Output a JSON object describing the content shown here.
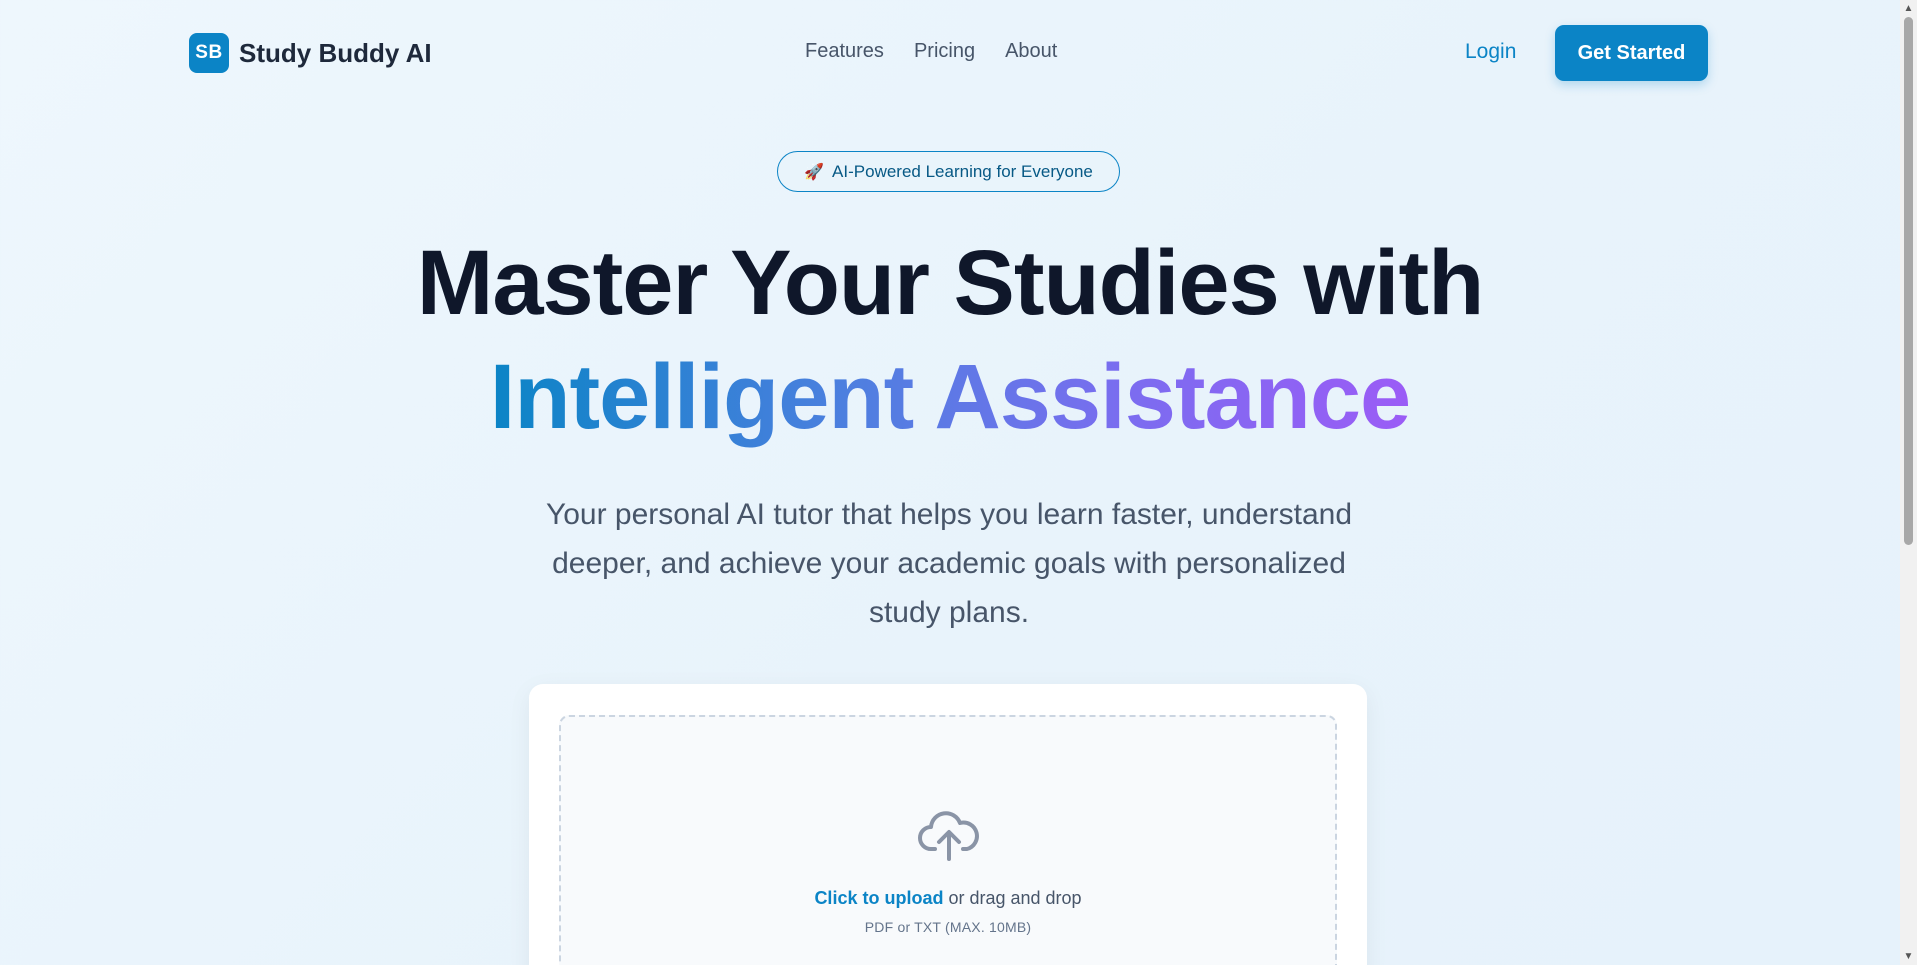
{
  "nav": {
    "logo_badge": "SB",
    "brand": "Study Buddy AI",
    "links": [
      "Features",
      "Pricing",
      "About"
    ],
    "login": "Login",
    "cta": "Get Started"
  },
  "hero": {
    "badge_icon": "rocket-icon",
    "badge": "AI-Powered Learning for Everyone",
    "headline_line1": "Master Your Studies with",
    "headline_line2": "Intelligent Assistance",
    "subtitle": "Your personal AI tutor that helps you learn faster, understand deeper, and achieve your academic goals with personalized study plans."
  },
  "upload": {
    "icon": "cloud-upload-icon",
    "link_text": "Click to upload",
    "rest_text": " or drag and drop",
    "hint": "PDF or TXT (MAX. 10MB)"
  },
  "colors": {
    "primary": "#0b84c6",
    "gradient_start": "#0b84c6",
    "gradient_end": "#9b5cf6",
    "heading": "#0f172a",
    "body_text": "#475569"
  }
}
